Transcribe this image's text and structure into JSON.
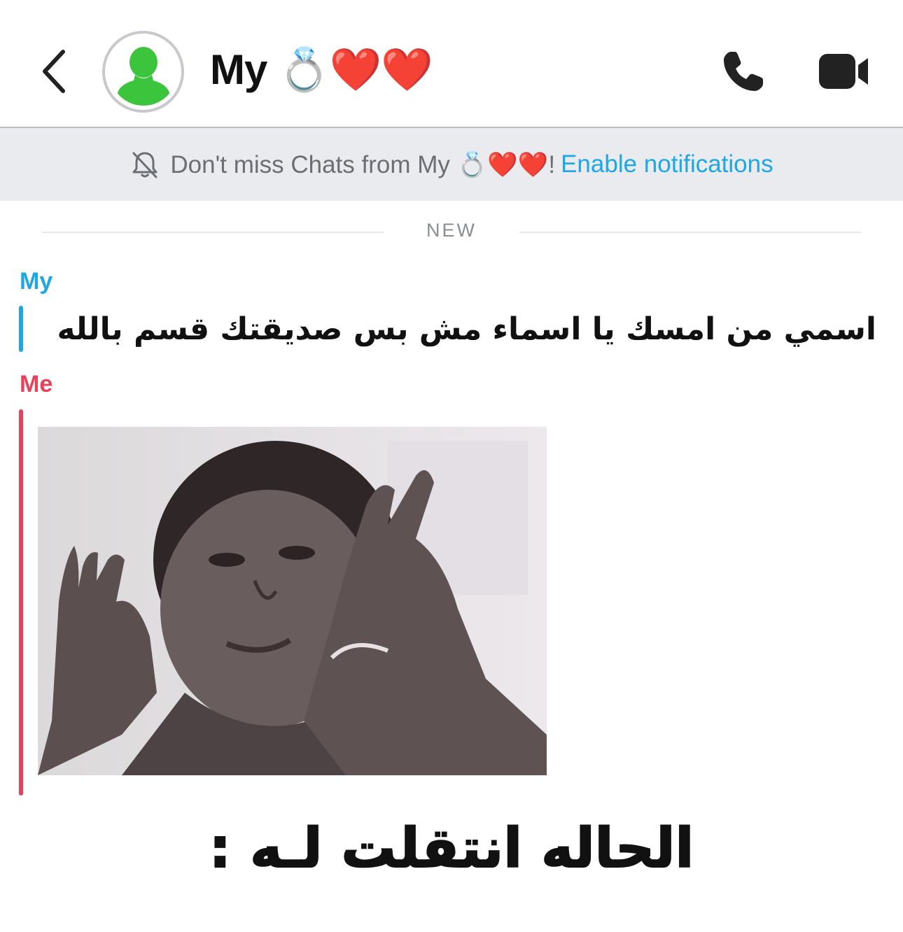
{
  "header": {
    "title": "My 💍❤️❤️",
    "back_icon": "chevron-left-icon",
    "avatar_icon": "person-silhouette-icon",
    "call_icon": "phone-icon",
    "video_icon": "video-camera-icon"
  },
  "banner": {
    "text": "Don't miss Chats from My 💍❤️❤️!",
    "link": "Enable notifications",
    "icon": "bell-muted-icon"
  },
  "divider": {
    "label": "NEW"
  },
  "messages": [
    {
      "sender": "My",
      "text": "اسمي من امسك يا اسماء مش بس صديقتك قسم بالله",
      "sender_color": "#1ea7e4"
    },
    {
      "sender": "Me",
      "sender_color": "#e6425c",
      "attachment": "gif"
    }
  ],
  "overlay": {
    "caption": "الحاله انتقلت لـه :"
  },
  "colors": {
    "accent_blue": "#1ea7e4",
    "accent_red": "#e6425c",
    "avatar_green": "#3cc43c",
    "banner_bg": "#e9ebee"
  }
}
